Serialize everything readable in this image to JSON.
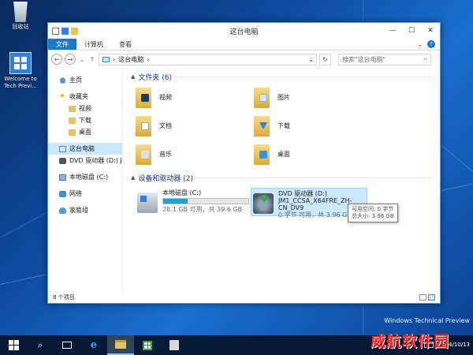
{
  "desktop": {
    "recycle_bin": "回收站",
    "welcome": "Welcome to Tech Previ...",
    "watermark": "Windows Technical Preview"
  },
  "window": {
    "title": "这台电脑",
    "controls": {
      "minimize": "—",
      "maximize": "☐",
      "close": "✕"
    }
  },
  "ribbon": {
    "tabs": [
      "文件",
      "计算机",
      "查看"
    ],
    "collapse": "⌄",
    "help": "?"
  },
  "nav": {
    "back": "←",
    "forward": "→",
    "recent": "⌄",
    "up": "↑",
    "address": "这台电脑",
    "address_chevron": "›",
    "address_dropdown": "⌄",
    "refresh": "↻",
    "search_placeholder": "搜索\"这台电脑\"",
    "search_icon": "⌕"
  },
  "sidebar": {
    "items": [
      {
        "label": "主页",
        "icon": "home-icon"
      },
      {
        "label": "收藏夹",
        "icon": "star-icon"
      },
      {
        "label": "视频",
        "icon": "folder-icon"
      },
      {
        "label": "下载",
        "icon": "folder-icon"
      },
      {
        "label": "桌面",
        "icon": "folder-icon"
      },
      {
        "label": "这台电脑",
        "icon": "computer-icon"
      },
      {
        "label": "DVD 驱动器 (D:) JM",
        "icon": "dvd-icon"
      },
      {
        "label": "本地磁盘 (C:)",
        "icon": "drive-icon"
      },
      {
        "label": "网络",
        "icon": "network-icon"
      },
      {
        "label": "家庭组",
        "icon": "homegroup-icon"
      }
    ]
  },
  "folders": {
    "header": "文件夹 (6)",
    "items": [
      {
        "label": "视频",
        "icon": "videos-folder-icon"
      },
      {
        "label": "图片",
        "icon": "pictures-folder-icon"
      },
      {
        "label": "文档",
        "icon": "documents-folder-icon"
      },
      {
        "label": "下载",
        "icon": "downloads-folder-icon"
      },
      {
        "label": "音乐",
        "icon": "music-folder-icon"
      },
      {
        "label": "桌面",
        "icon": "desktop-folder-icon"
      }
    ]
  },
  "devices": {
    "header": "设备和驱动器 (2)",
    "c_drive": {
      "name": "本地磁盘 (C:)",
      "space": "28.1 GB 可用，共 39.6 GB",
      "used_fraction": 0.29
    },
    "d_drive": {
      "name": "DVD 驱动器 (D:)",
      "volume": "JM1_CCSA_X64FRE_ZH-CN_DV9",
      "space": "0 字节 可用，共 3.96 GB"
    }
  },
  "tooltip": {
    "line1": "可用空间: 0 字节",
    "line2": "总大小: 3.96 GB"
  },
  "status": {
    "item_count": "8 个项目"
  },
  "taskbar": {
    "search_icon": "⌕",
    "brand": "威航软件园",
    "date": "2014/10/13"
  },
  "colors": {
    "accent": "#1979ca",
    "selection": "#cce8ff",
    "progress": "#26a0da",
    "group_header": "#1e3287",
    "brand": "#e22222"
  }
}
